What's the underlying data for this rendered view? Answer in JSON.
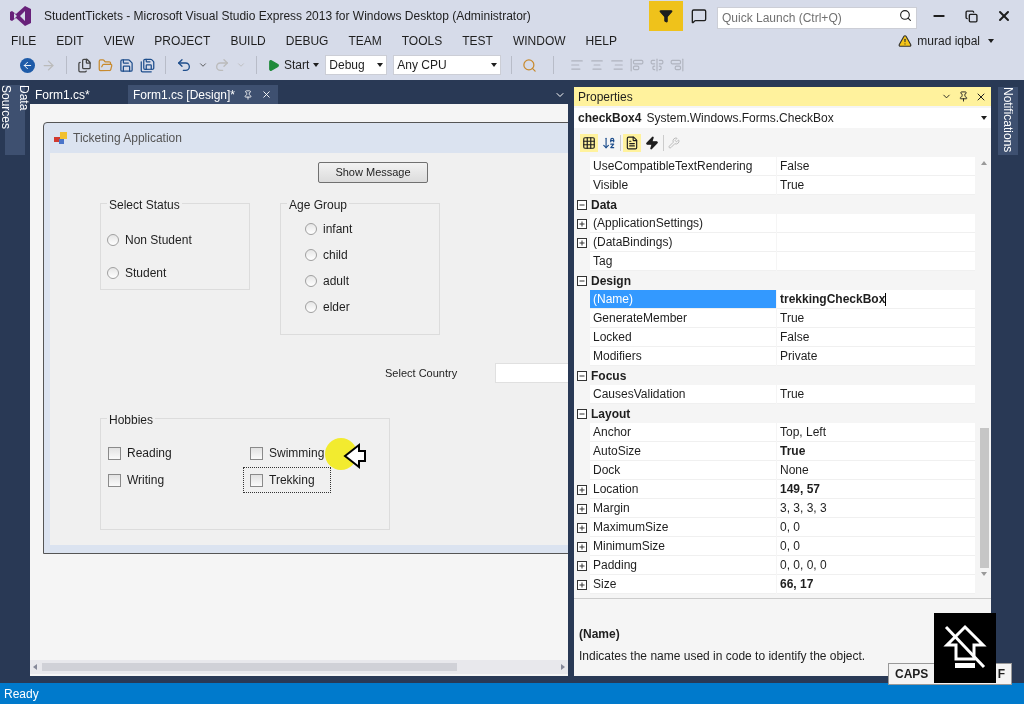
{
  "window": {
    "title": "StudentTickets - Microsoft Visual Studio Express 2013 for Windows Desktop (Administrator)"
  },
  "quick_launch": {
    "placeholder": "Quick Launch (Ctrl+Q)"
  },
  "menu": [
    "FILE",
    "EDIT",
    "VIEW",
    "PROJECT",
    "BUILD",
    "DEBUG",
    "TEAM",
    "TOOLS",
    "TEST",
    "WINDOW",
    "HELP"
  ],
  "user": {
    "name": "murad iqbal"
  },
  "toolbar": {
    "start": "Start",
    "configuration": "Debug",
    "platform": "Any CPU"
  },
  "side_tabs": {
    "left": "Data Sources",
    "right": "Notifications"
  },
  "document_tabs": [
    {
      "label": "Form1.cs*",
      "selected": false
    },
    {
      "label": "Form1.cs [Design]*",
      "selected": true
    }
  ],
  "form": {
    "title": "Ticketing Application",
    "button": "Show Message",
    "country_label": "Select Country",
    "status_group": {
      "title": "Select Status",
      "options": [
        {
          "label": "Non Student",
          "checked": false
        },
        {
          "label": "Student",
          "checked": false
        }
      ]
    },
    "age_group": {
      "title": "Age Group",
      "options": [
        {
          "label": "infant",
          "checked": false
        },
        {
          "label": "child",
          "checked": false
        },
        {
          "label": "adult",
          "checked": false
        },
        {
          "label": "elder",
          "checked": false
        }
      ]
    },
    "hobbies": {
      "title": "Hobbies",
      "options": [
        {
          "label": "Reading",
          "checked": false,
          "selected": false
        },
        {
          "label": "Swimming",
          "checked": false,
          "selected": false
        },
        {
          "label": "Writing",
          "checked": false,
          "selected": false
        },
        {
          "label": "Trekking",
          "checked": false,
          "selected": true
        }
      ]
    }
  },
  "properties": {
    "title": "Properties",
    "object_name": "checkBox4",
    "object_type": "System.Windows.Forms.CheckBox",
    "rows": [
      {
        "kind": "property",
        "name": "UseCompatibleTextRendering",
        "value": "False",
        "expandable": false,
        "modified": false,
        "selected": false
      },
      {
        "kind": "property",
        "name": "Visible",
        "value": "True",
        "expandable": false,
        "modified": false,
        "selected": false
      },
      {
        "kind": "category",
        "name": "Data",
        "expanded": true
      },
      {
        "kind": "property",
        "name": "(ApplicationSettings)",
        "expandable": true,
        "selected": false
      },
      {
        "kind": "property",
        "name": "(DataBindings)",
        "expandable": true,
        "selected": false
      },
      {
        "kind": "property",
        "name": "Tag",
        "expandable": false,
        "selected": false
      },
      {
        "kind": "category",
        "name": "Design",
        "expanded": true
      },
      {
        "kind": "property",
        "name": "(Name)",
        "value": "trekkingCheckBox",
        "expandable": false,
        "modified": true,
        "selected": true
      },
      {
        "kind": "property",
        "name": "GenerateMember",
        "value": "True",
        "expandable": false,
        "modified": false,
        "selected": false
      },
      {
        "kind": "property",
        "name": "Locked",
        "value": "False",
        "expandable": false,
        "modified": false,
        "selected": false
      },
      {
        "kind": "property",
        "name": "Modifiers",
        "value": "Private",
        "expandable": false,
        "modified": false,
        "selected": false
      },
      {
        "kind": "category",
        "name": "Focus",
        "expanded": true
      },
      {
        "kind": "property",
        "name": "CausesValidation",
        "value": "True",
        "expandable": false,
        "modified": false,
        "selected": false
      },
      {
        "kind": "category",
        "name": "Layout",
        "expanded": true
      },
      {
        "kind": "property",
        "name": "Anchor",
        "value": "Top, Left",
        "expandable": false,
        "modified": false,
        "selected": false
      },
      {
        "kind": "property",
        "name": "AutoSize",
        "value": "True",
        "expandable": false,
        "modified": true,
        "selected": false
      },
      {
        "kind": "property",
        "name": "Dock",
        "value": "None",
        "expandable": false,
        "modified": false,
        "selected": false
      },
      {
        "kind": "property",
        "name": "Location",
        "value": "149, 57",
        "expandable": true,
        "modified": true,
        "selected": false
      },
      {
        "kind": "property",
        "name": "Margin",
        "value": "3, 3, 3, 3",
        "expandable": true,
        "modified": false,
        "selected": false
      },
      {
        "kind": "property",
        "name": "MaximumSize",
        "value": "0, 0",
        "expandable": true,
        "modified": false,
        "selected": false
      },
      {
        "kind": "property",
        "name": "MinimumSize",
        "value": "0, 0",
        "expandable": true,
        "modified": false,
        "selected": false
      },
      {
        "kind": "property",
        "name": "Padding",
        "value": "0, 0, 0, 0",
        "expandable": true,
        "modified": false,
        "selected": false
      },
      {
        "kind": "property",
        "name": "Size",
        "value": "66, 17",
        "expandable": true,
        "modified": true,
        "selected": false
      }
    ],
    "description": {
      "title": "(Name)",
      "text": "Indicates the name used in code to identify the object."
    }
  },
  "caps_indicator": {
    "left_text": "CAPS",
    "right_text": "F"
  },
  "status_bar": {
    "text": "Ready"
  }
}
